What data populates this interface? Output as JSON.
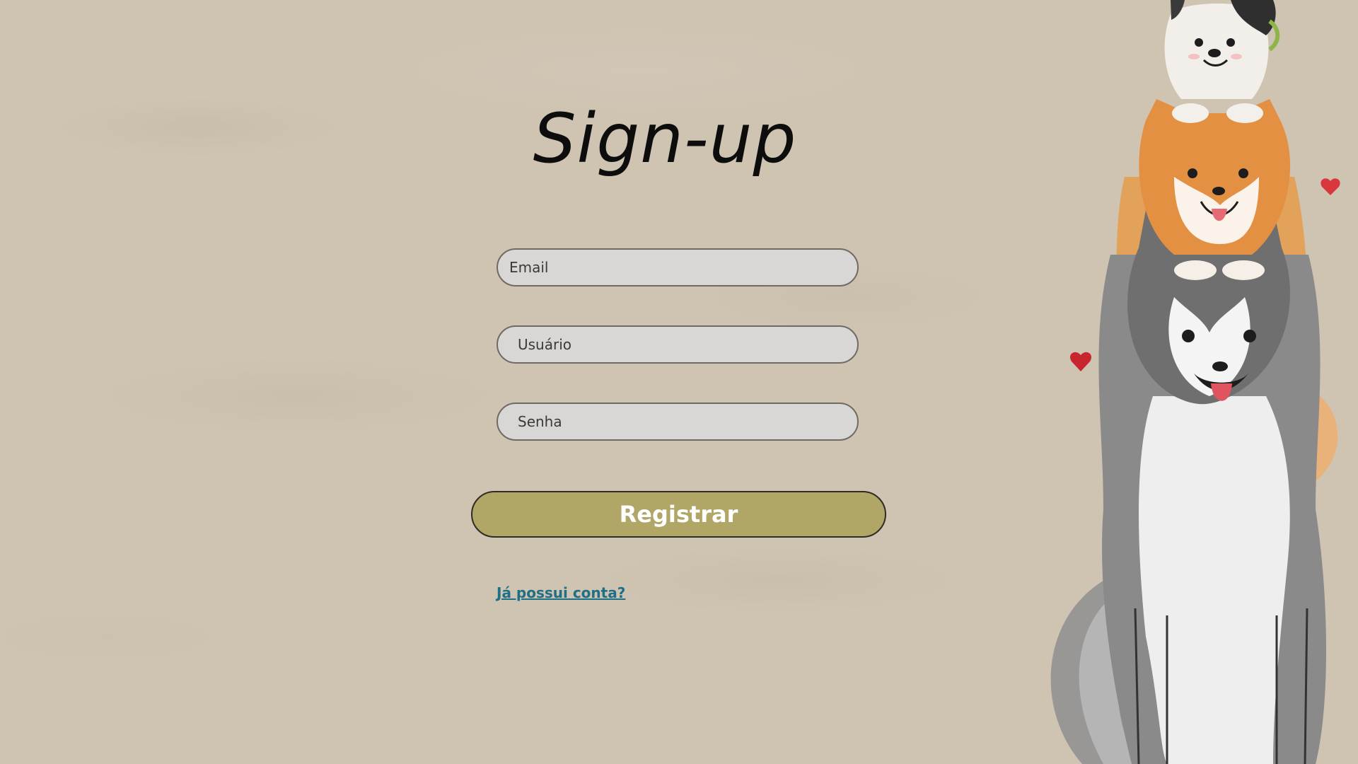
{
  "title": "Sign-up",
  "form": {
    "email_placeholder": "Email",
    "username_placeholder": "Usuário",
    "password_placeholder": "Senha",
    "register_label": "Registrar",
    "login_link": "Já possui conta?"
  },
  "colors": {
    "background": "#cfc3b2",
    "button": "#b0a666",
    "link": "#1f6f86",
    "field": "#d8d7d5"
  },
  "illustration": {
    "icons": [
      "dog-stack-illustration",
      "heart-icon"
    ]
  }
}
